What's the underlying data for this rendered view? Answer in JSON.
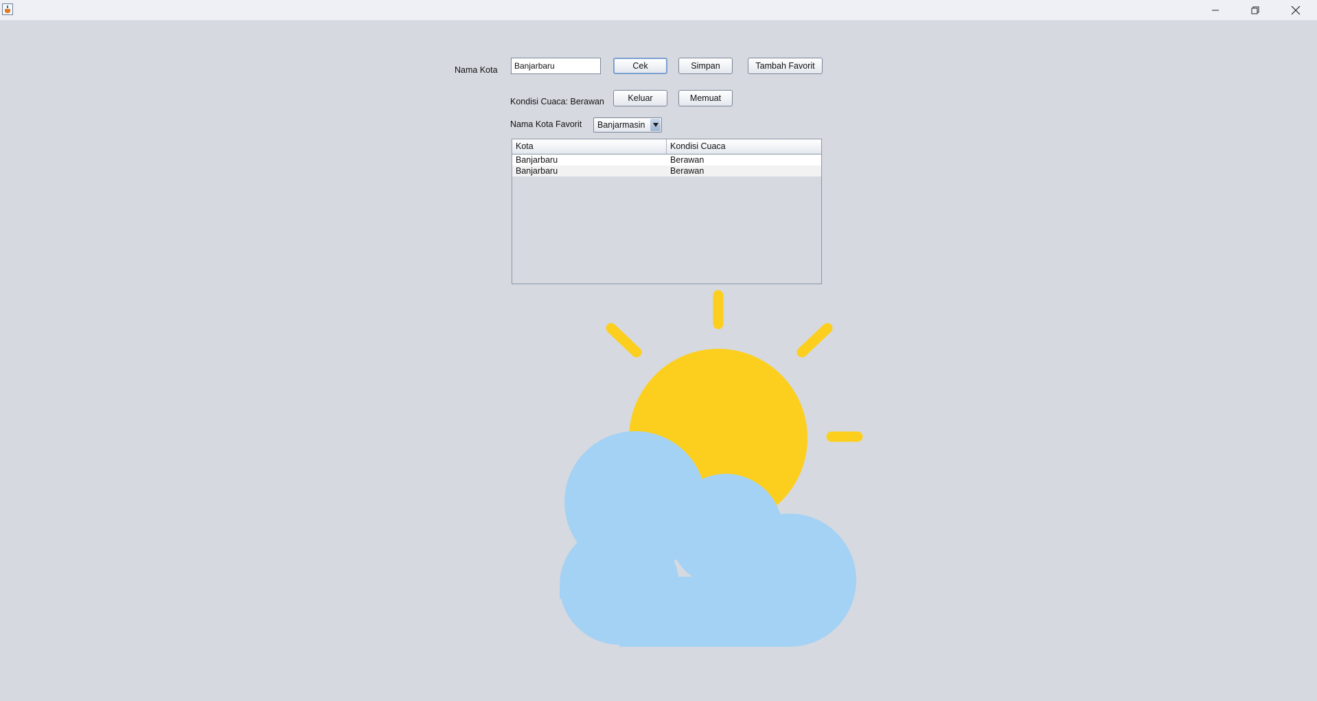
{
  "window": {
    "icon": "java-cup-icon",
    "controls": [
      "minimize-icon",
      "restore-icon",
      "close-icon"
    ]
  },
  "form": {
    "city_label": "Nama Kota",
    "city_value": "Banjarbaru",
    "buttons": {
      "check": "Cek",
      "save": "Simpan",
      "add_favorite": "Tambah Favorit",
      "exit": "Keluar",
      "load": "Memuat"
    },
    "weather_status": "Kondisi Cuaca: Berawan",
    "favorite_label": "Nama Kota Favorit",
    "favorite_selected": "Banjarmasin"
  },
  "table": {
    "columns": [
      "Kota",
      "Kondisi Cuaca"
    ],
    "rows": [
      [
        "Banjarbaru",
        "Berawan"
      ],
      [
        "Banjarbaru",
        "Berawan"
      ]
    ]
  },
  "illustration": {
    "icon": "partly-cloudy-icon",
    "sun_color": "#FCCF1F",
    "cloud_color": "#A4D2F4"
  }
}
